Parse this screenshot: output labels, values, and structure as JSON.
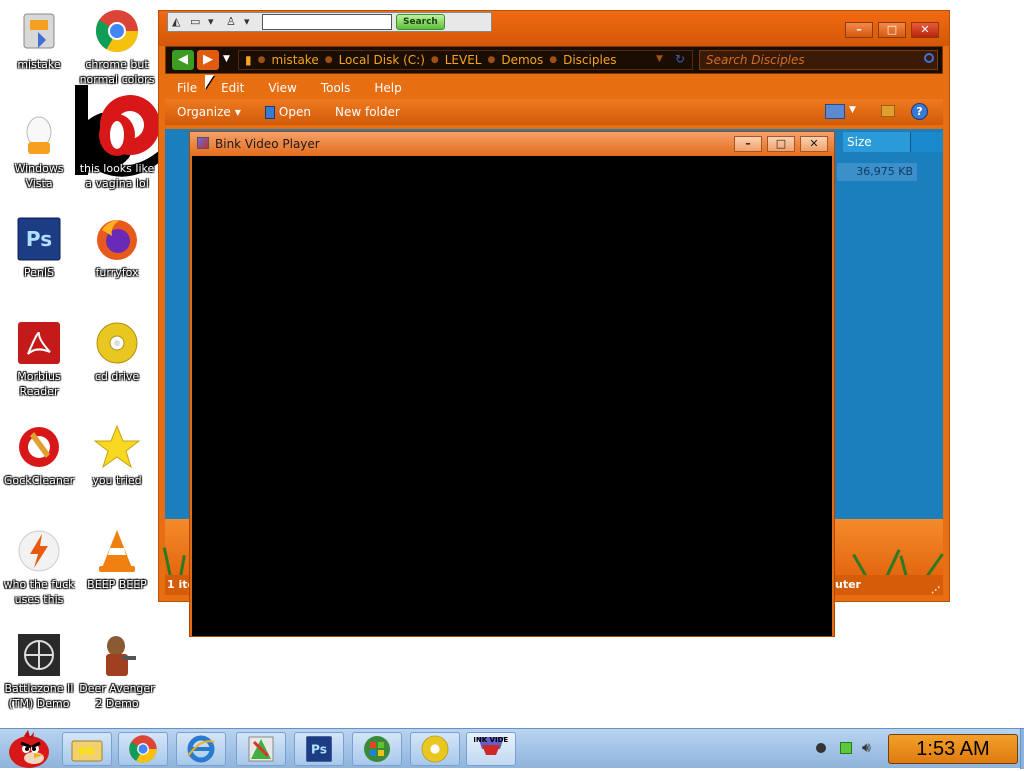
{
  "desktop": {
    "icons": [
      {
        "label": "mistake"
      },
      {
        "label": "chrome but normal colors"
      },
      {
        "label": "Windows Vista"
      },
      {
        "label": "this looks like a vagina lol"
      },
      {
        "label": "PenIS"
      },
      {
        "label": "furryfox"
      },
      {
        "label": "Morbius Reader"
      },
      {
        "label": "cd drive"
      },
      {
        "label": "GockCleaner"
      },
      {
        "label": "you tried"
      },
      {
        "label": "who the fuck uses this"
      },
      {
        "label": "BEEP BEEP"
      },
      {
        "label": "Battlezone II (TM) Demo"
      },
      {
        "label": "Deer Avenger 2 Demo"
      }
    ]
  },
  "explorer": {
    "mini_toolbar": {
      "search_button": "Search"
    },
    "address": {
      "crumbs": [
        "mistake",
        "Local Disk (C:)",
        "LEVEL",
        "Demos",
        "Disciples"
      ]
    },
    "search_placeholder": "Search Disciples",
    "menu": [
      "File",
      "Edit",
      "View",
      "Tools",
      "Help"
    ],
    "commands": {
      "organize": "Organize",
      "open": "Open",
      "new_folder": "New folder"
    },
    "columns": {
      "size": "Size"
    },
    "file": {
      "size": "36,975 KB"
    },
    "status": {
      "left": "1 ite",
      "right": "uter"
    }
  },
  "bink": {
    "title": "Bink Video Player"
  },
  "taskbar": {
    "clock": "1:53 AM",
    "bink_label": "BINK VIDEO"
  },
  "colors": {
    "explorer_orange": "#e86e12",
    "content_blue": "#1b7fbd",
    "clock_orange": "#f2a02a"
  }
}
